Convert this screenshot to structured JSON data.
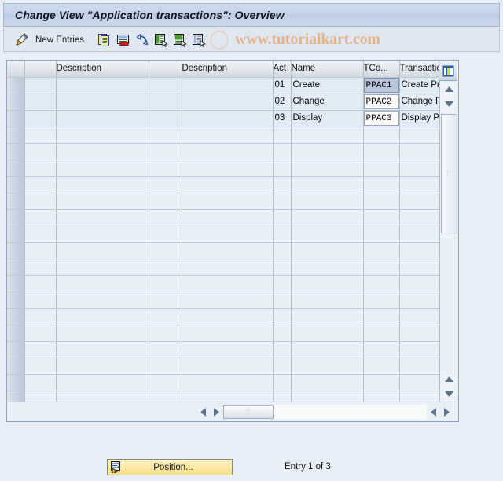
{
  "window": {
    "title": "Change View \"Application transactions\": Overview"
  },
  "toolbar": {
    "pencil_icon": "change-pencil-icon",
    "new_entries_label": "New Entries",
    "icons": [
      {
        "name": "copy-icon",
        "title": "Copy As..."
      },
      {
        "name": "delete-icon",
        "title": "Delete"
      },
      {
        "name": "undo-icon",
        "title": "Undo Change"
      },
      {
        "name": "select-all-icon",
        "title": "Select All"
      },
      {
        "name": "select-block-icon",
        "title": "Select Block"
      },
      {
        "name": "deselect-all-icon",
        "title": "Deselect All"
      }
    ],
    "watermark": "www.tutorialkart.com"
  },
  "table": {
    "columns": [
      {
        "key": "sel",
        "label": ""
      },
      {
        "key": "a",
        "label": ""
      },
      {
        "key": "desc1",
        "label": "Description"
      },
      {
        "key": "b",
        "label": ""
      },
      {
        "key": "desc2",
        "label": "Description"
      },
      {
        "key": "act",
        "label": "Act"
      },
      {
        "key": "name",
        "label": "Name"
      },
      {
        "key": "tco",
        "label": "TCo..."
      },
      {
        "key": "ttext",
        "label": "Transaction Te"
      }
    ],
    "config_icon": "column-config-icon",
    "rows": [
      {
        "a": "",
        "desc1": "",
        "b": "",
        "desc2": "",
        "act": "01",
        "name": "Create",
        "tco": "PPAC1",
        "ttext": "Create Prepaid",
        "tco_selected": true
      },
      {
        "a": "",
        "desc1": "",
        "b": "",
        "desc2": "",
        "act": "02",
        "name": "Change",
        "tco": "PPAC2",
        "ttext": "Change Prepai",
        "tco_selected": false
      },
      {
        "a": "",
        "desc1": "",
        "b": "",
        "desc2": "",
        "act": "03",
        "name": "Display",
        "tco": "PPAC3",
        "ttext": "Display Prepaid",
        "tco_selected": false
      }
    ],
    "empty_row_count": 17
  },
  "scrollbars": {
    "vertical": {
      "up_arrow": "scroll-up-icon",
      "down_arrow": "scroll-down-icon",
      "thumb_grip": "grip-dots"
    },
    "horizontal": {
      "left_arrow": "scroll-left-icon",
      "right_arrow": "scroll-right-icon",
      "thumb_grip": "grip-dots"
    }
  },
  "footer": {
    "position_button_label": "Position...",
    "position_button_icon": "position-icon",
    "entry_status": "Entry 1 of 3"
  },
  "colors": {
    "window_bg": "#e8eef7",
    "title_bar": "#c3d3e8",
    "toolbar_bg": "#dfe7f2",
    "grid_border": "#8ba6c4",
    "row_data_bg": "#e2ecf6",
    "row_empty_bg": "#eaf0f8",
    "selected_cell": "#b7c6d9",
    "watermark": "#e6b183",
    "button_yellow": "#fbe9a6"
  }
}
